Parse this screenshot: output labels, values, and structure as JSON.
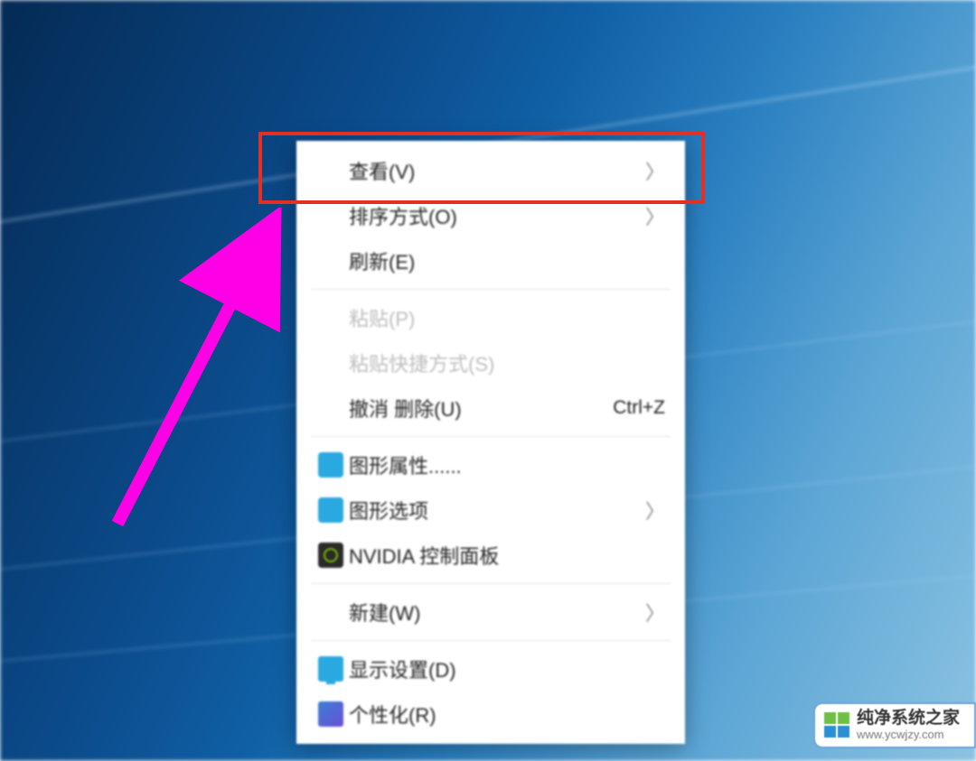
{
  "menu": {
    "view": {
      "label": "查看(V)",
      "submenu": true
    },
    "sort": {
      "label": "排序方式(O)",
      "submenu": true
    },
    "refresh": {
      "label": "刷新(E)"
    },
    "paste": {
      "label": "粘贴(P)",
      "disabled": true
    },
    "paste_shortcut": {
      "label": "粘贴快捷方式(S)",
      "disabled": true
    },
    "undo_delete": {
      "label": "撤消 删除(U)",
      "shortcut": "Ctrl+Z"
    },
    "gfx_props": {
      "label": "图形属性......",
      "icon": "intel"
    },
    "gfx_options": {
      "label": "图形选项",
      "icon": "intel",
      "submenu": true
    },
    "nvidia_cp": {
      "label": "NVIDIA 控制面板",
      "icon": "nvidia"
    },
    "new": {
      "label": "新建(W)",
      "submenu": true
    },
    "display": {
      "label": "显示设置(D)",
      "icon": "display"
    },
    "personalize": {
      "label": "个性化(R)",
      "icon": "personalize"
    }
  },
  "highlight": {
    "target": "menu.view",
    "color": "#e33022"
  },
  "arrow": {
    "color": "#ff00e6"
  },
  "watermark": {
    "title": "纯净系统之家",
    "url": "www.ycwjzy.com"
  },
  "chevron_glyph": "〉"
}
